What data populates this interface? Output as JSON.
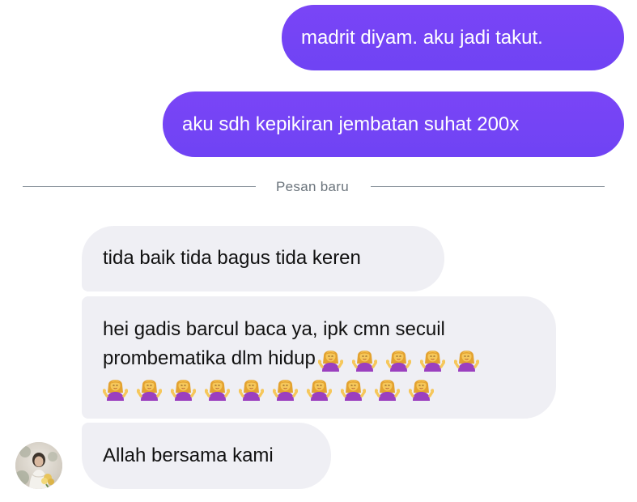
{
  "conversation": {
    "outgoing": [
      {
        "text": "madrit diyam. aku jadi takut."
      },
      {
        "text": "aku sdh kepikiran jembatan suhat 200x"
      }
    ],
    "divider": {
      "label": "Pesan baru"
    },
    "incoming": [
      {
        "text": "tida baik tida bagus tida keren"
      },
      {
        "line1": "hei gadis barcul baca ya, ipk cmn secuil",
        "line2": "prombematika dlm hidup",
        "emoji": "person-tipping-hand-emoji",
        "emoji_count_line2": 5,
        "emoji_count_line3": 10
      },
      {
        "text": "Allah bersama kami"
      }
    ]
  },
  "colors": {
    "outgoing_bubble": "#7444f5",
    "incoming_bubble": "#efeff4",
    "divider": "#7d8891"
  },
  "icons": {
    "avatar": "contact-avatar-photo",
    "emoji": "person-tipping-hand-emoji"
  }
}
